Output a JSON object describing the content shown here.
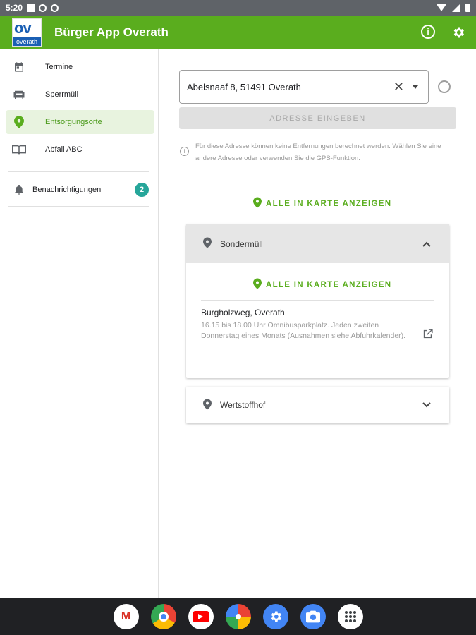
{
  "status_bar": {
    "time": "5:20"
  },
  "app_bar": {
    "title": "Bürger App Overath",
    "logo_text": "ov",
    "logo_band_text": "overath",
    "accent": "#5aad1e"
  },
  "sidebar": {
    "items": [
      {
        "label": "Termine",
        "icon": "calendar-icon"
      },
      {
        "label": "Sperrmüll",
        "icon": "sofa-icon"
      },
      {
        "label": "Entsorgungsorte",
        "icon": "map-pin-icon",
        "active": true
      },
      {
        "label": "Abfall ABC",
        "icon": "book-icon"
      }
    ],
    "notifications": {
      "label": "Benachrichtigungen",
      "count": "2",
      "icon": "bell-icon"
    }
  },
  "address": {
    "value": "Abelsnaaf 8, 51491 Overath",
    "button_label": "ADRESSE EINGEBEN",
    "hint": "Für diese Adresse können keine Entfernungen berechnet werden. Wählen Sie eine andere Adresse oder verwenden Sie die GPS-Funktion."
  },
  "show_all_label": "ALLE IN KARTE ANZEIGEN",
  "categories": [
    {
      "name": "Sondermüll",
      "expanded": true,
      "show_all_label": "ALLE IN KARTE ANZEIGEN",
      "entries": [
        {
          "title": "Burgholzweg, Overath",
          "description": "16.15 bis 18.00 Uhr Omnibusparkplatz. Jeden zweiten Donnerstag eines Monats (Ausnahmen siehe Abfuhrkalender)."
        }
      ]
    },
    {
      "name": "Wertstoffhof",
      "expanded": false
    }
  ]
}
